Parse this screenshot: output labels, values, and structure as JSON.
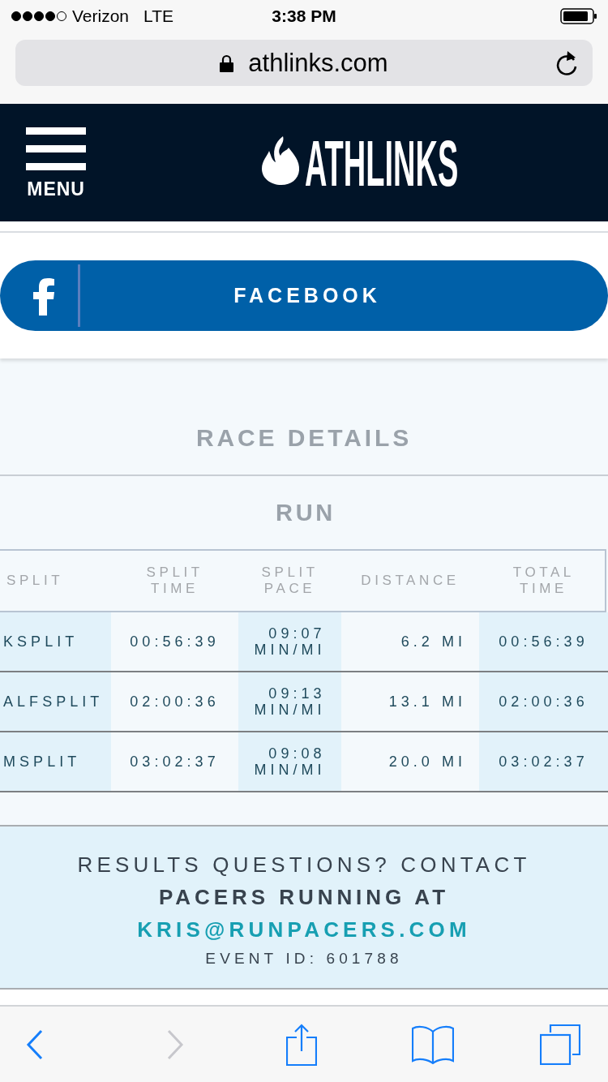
{
  "status_bar": {
    "carrier": "Verizon",
    "network": "LTE",
    "time": "3:38 PM"
  },
  "address_bar": {
    "url": "athlinks.com"
  },
  "header": {
    "menu_label": "MENU",
    "logo_text": "ATHLINKS"
  },
  "social_login": {
    "label": "FACEBOOK"
  },
  "race_details": {
    "title": "RACE DETAILS",
    "section": "RUN",
    "table": {
      "columns": [
        "SPLIT",
        "SPLIT TIME",
        "SPLIT PACE",
        "DISTANCE",
        "TOTAL TIME"
      ],
      "rows": [
        [
          "KSPLIT",
          "00:56:39",
          "09:07 MIN/MI",
          "6.2 MI",
          "00:56:39"
        ],
        [
          "ALFSPLIT",
          "02:00:36",
          "09:13 MIN/MI",
          "13.1 MI",
          "02:00:36"
        ],
        [
          "MSPLIT",
          "03:02:37",
          "09:08 MIN/MI",
          "20.0 MI",
          "03:02:37"
        ]
      ]
    }
  },
  "contact": {
    "text": "RESULTS QUESTIONS? CONTACT **PACERS RUNNING AT**",
    "email": "KRIS@RUNPACERS.COM",
    "event_id": "EVENT ID: 601788"
  },
  "toolbar": {
    "back": {
      "disabled": false
    },
    "forward": {
      "disabled": true
    }
  }
}
